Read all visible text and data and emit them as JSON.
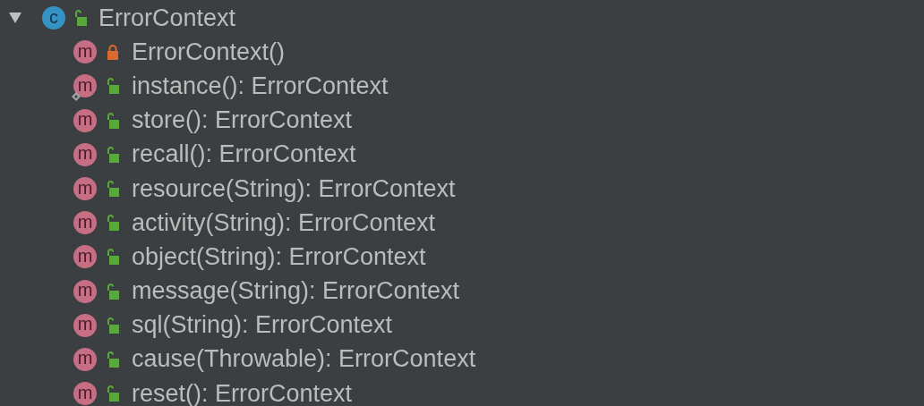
{
  "structure_tree": {
    "label": "ErrorContext",
    "kind": "class",
    "badge": "c",
    "locked": false,
    "expanded": true,
    "children": [
      {
        "label": "ErrorContext()",
        "kind": "method",
        "badge": "m",
        "locked": true,
        "static": false
      },
      {
        "label": "instance(): ErrorContext",
        "kind": "method",
        "badge": "m",
        "locked": false,
        "static": true
      },
      {
        "label": "store(): ErrorContext",
        "kind": "method",
        "badge": "m",
        "locked": false,
        "static": false
      },
      {
        "label": "recall(): ErrorContext",
        "kind": "method",
        "badge": "m",
        "locked": false,
        "static": false
      },
      {
        "label": "resource(String): ErrorContext",
        "kind": "method",
        "badge": "m",
        "locked": false,
        "static": false
      },
      {
        "label": "activity(String): ErrorContext",
        "kind": "method",
        "badge": "m",
        "locked": false,
        "static": false
      },
      {
        "label": "object(String): ErrorContext",
        "kind": "method",
        "badge": "m",
        "locked": false,
        "static": false
      },
      {
        "label": "message(String): ErrorContext",
        "kind": "method",
        "badge": "m",
        "locked": false,
        "static": false
      },
      {
        "label": "sql(String): ErrorContext",
        "kind": "method",
        "badge": "m",
        "locked": false,
        "static": false
      },
      {
        "label": "cause(Throwable): ErrorContext",
        "kind": "method",
        "badge": "m",
        "locked": false,
        "static": false
      },
      {
        "label": "reset(): ErrorContext",
        "kind": "method",
        "badge": "m",
        "locked": false,
        "static": false
      }
    ]
  }
}
